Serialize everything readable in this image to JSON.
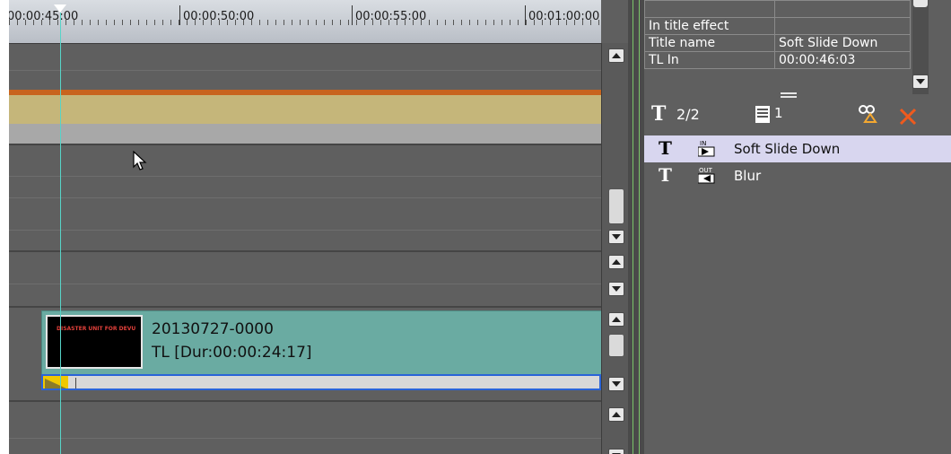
{
  "timeline": {
    "ruler_labels": [
      "00:00:45:00",
      "00:00:50:00",
      "00:00:55:00",
      "00:01:00:00"
    ],
    "clip": {
      "thumbnail_text": "DISASTER UNIT FOR DEVU",
      "name": "20130727-0000",
      "duration": "TL [Dur:00:00:24:17]"
    }
  },
  "properties": {
    "rows": [
      {
        "label": "",
        "value": ""
      },
      {
        "label": "In title effect",
        "value": ""
      },
      {
        "label": "Title name",
        "value": "Soft Slide Down"
      },
      {
        "label": "TL In",
        "value": "00:00:46:03"
      }
    ]
  },
  "panel_toolbar": {
    "title_count": "2/2",
    "track_number": "1"
  },
  "effects_list": [
    {
      "badge": "IN",
      "label": "Soft Slide Down",
      "selected": true
    },
    {
      "badge": "OUT",
      "label": "Blur",
      "selected": false
    }
  ],
  "colors": {
    "clip": "#6aaba2",
    "cursor": "#57d4c8",
    "selection": "#d8d6ef",
    "delete": "#ef5a1e",
    "track_gold": "#c5b67a"
  },
  "icons": {
    "title": "title-T-icon",
    "track": "track-icon",
    "effect": "effect-settings-icon",
    "delete": "close-x-icon"
  }
}
